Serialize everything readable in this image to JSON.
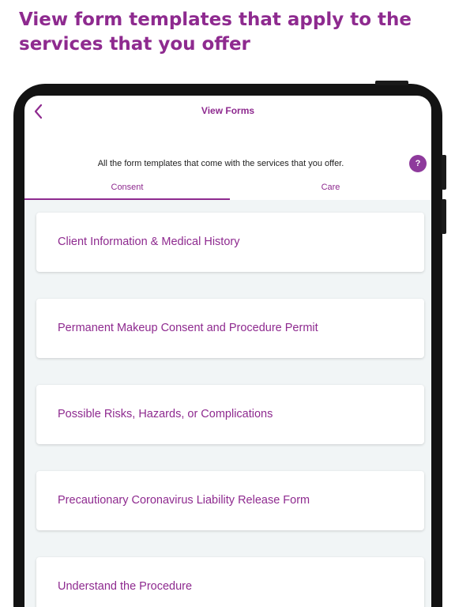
{
  "headline": "View form templates that apply to the services that you offer",
  "nav": {
    "title": "View Forms"
  },
  "subtitle": "All the form templates that come with the services that you offer.",
  "help": {
    "label": "?"
  },
  "tabs": [
    {
      "label": "Consent",
      "active": true
    },
    {
      "label": "Care",
      "active": false
    }
  ],
  "forms": [
    {
      "label": "Client Information & Medical History"
    },
    {
      "label": "Permanent Makeup Consent and Procedure Permit"
    },
    {
      "label": "Possible Risks, Hazards, or Complications"
    },
    {
      "label": "Precautionary Coronavirus Liability Release Form"
    },
    {
      "label": "Understand the Procedure"
    }
  ],
  "colors": {
    "accent": "#8e2a8f",
    "list_background": "#f1f5f6",
    "device_frame": "#131313"
  },
  "icons": {
    "back": "chevron-left-icon",
    "help": "question-icon"
  }
}
